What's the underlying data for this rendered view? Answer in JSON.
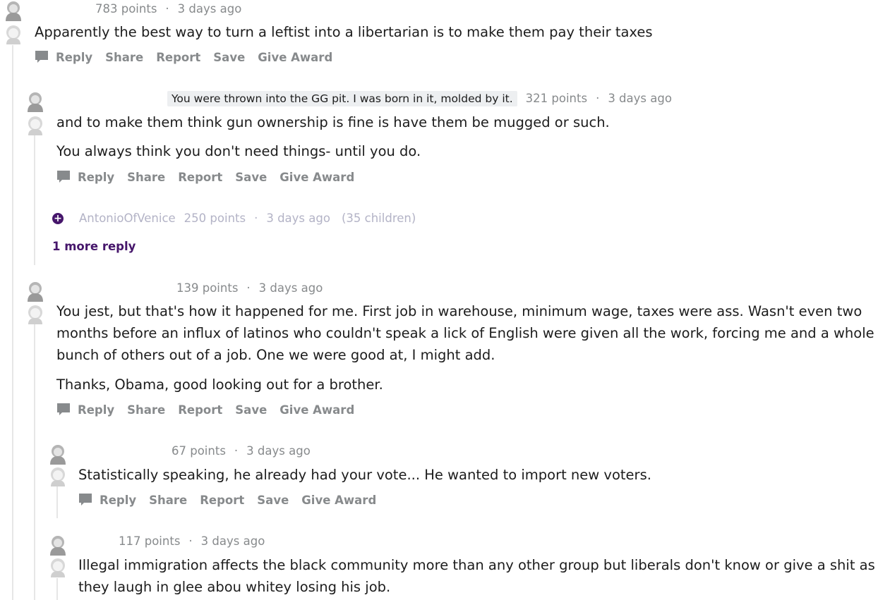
{
  "comments": [
    {
      "meta": {
        "points": "783 points",
        "sep": "·",
        "time": "3 days ago"
      },
      "paragraphs": [
        "Apparently the best way to turn a leftist into a libertarian is to make them pay their taxes"
      ],
      "actions": {
        "reply": "Reply",
        "share": "Share",
        "report": "Report",
        "save": "Save",
        "award": "Give Award"
      }
    },
    {
      "meta": {
        "flair": "You were thrown into the GG pit. I was born in it, molded by it.",
        "points": "321 points",
        "sep": "·",
        "time": "3 days ago"
      },
      "paragraphs": [
        "and to make them think gun ownership is fine is have them be mugged or such.",
        "You always think you don't need things- until you do."
      ],
      "actions": {
        "reply": "Reply",
        "share": "Share",
        "report": "Report",
        "save": "Save",
        "award": "Give Award"
      }
    },
    {
      "meta": {
        "points": "139 points",
        "sep": "·",
        "time": "3 days ago"
      },
      "paragraphs": [
        "You jest, but that's how it happened for me. First job in warehouse, minimum wage, taxes were ass. Wasn't even two months before an influx of latinos who couldn't speak a lick of English were given all the work, forcing me and a whole bunch of others out of a job. One we were good at, I might add.",
        "Thanks, Obama, good looking out for a brother."
      ],
      "actions": {
        "reply": "Reply",
        "share": "Share",
        "report": "Report",
        "save": "Save",
        "award": "Give Award"
      }
    },
    {
      "meta": {
        "points": "67 points",
        "sep": "·",
        "time": "3 days ago"
      },
      "paragraphs": [
        "Statistically speaking, he already had your vote... He wanted to import new voters."
      ],
      "actions": {
        "reply": "Reply",
        "share": "Share",
        "report": "Report",
        "save": "Save",
        "award": "Give Award"
      }
    },
    {
      "meta": {
        "points": "117 points",
        "sep": "·",
        "time": "3 days ago"
      },
      "paragraphs": [
        "Illegal immigration affects the black community more than any other group but liberals don't know or give a shit as they laugh in glee abou whitey losing his job."
      ]
    }
  ],
  "collapsed_comment": {
    "plus": "+",
    "user": "AntonioOfVenice",
    "points": "250 points",
    "sep": "·",
    "time": "3 days ago",
    "children": "(35 children)"
  },
  "more_reply": "1 more reply",
  "colors": {
    "accent": "#46166b",
    "muted": "#878a8c",
    "flair_bg": "#edeff1",
    "thread_line": "#e6e6e6"
  },
  "icons": [
    "avatar",
    "comment-bubble-icon",
    "expand-plus-icon"
  ]
}
